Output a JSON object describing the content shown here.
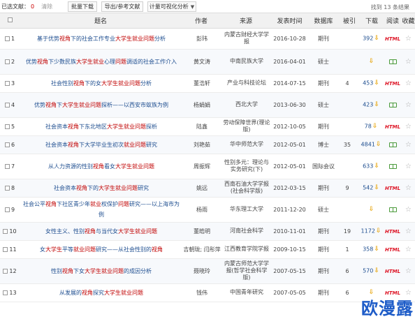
{
  "toolbar": {
    "selected_label": "已选文献：",
    "selected_count": "0",
    "clear_label": "清除",
    "batch_download": "批量下载",
    "export": "导出/参考文献",
    "visualize": "计量可视化分析",
    "found_text": "找到 13 条结果"
  },
  "columns": [
    "",
    "题名",
    "作者",
    "来源",
    "发表时间",
    "数据库",
    "被引",
    "下载",
    "阅读",
    "收藏"
  ],
  "rows": [
    {
      "num": "1",
      "title": "基于优势视角下的社会工作专业大学生就业问题分析",
      "author": "彭玮",
      "source": "内蒙古财经大学学报",
      "date": "2016-10-28",
      "db": "期刊",
      "cite": "",
      "downloads": "392",
      "read": "html"
    },
    {
      "num": "2",
      "title": "优势视角下少数民族大学生就业心理问题调适的社会工作介入",
      "author": "黄文涛",
      "source": "中南民族大学",
      "date": "2016-04-01",
      "db": "硕士",
      "cite": "",
      "downloads": "",
      "read": "book"
    },
    {
      "num": "3",
      "title": "社会性别视角下的女大学生就业问题分析",
      "author": "董浩轩",
      "source": "产业与科技论坛",
      "date": "2014-07-15",
      "db": "期刊",
      "cite": "4",
      "downloads": "453",
      "read": "html"
    },
    {
      "num": "4",
      "title": "优势视角下大学生就业问题探析——以西安市蚁族为例",
      "author": "杨娟娟",
      "source": "西北大学",
      "date": "2013-06-30",
      "db": "硕士",
      "cite": "",
      "downloads": "423",
      "read": "book"
    },
    {
      "num": "5",
      "title": "社会资本视角下东北地区大学生就业问题探析",
      "author": "陆鑫",
      "source": "劳动保障世界(理论版)",
      "date": "2012-10-05",
      "db": "期刊",
      "cite": "",
      "downloads": "78",
      "read": "html"
    },
    {
      "num": "6",
      "title": "社会资本视角下大学毕业生初次就业问题研究",
      "author": "刘艳茹",
      "source": "华中师范大学",
      "date": "2012-05-01",
      "db": "博士",
      "cite": "35",
      "downloads": "4841",
      "read": "book"
    },
    {
      "num": "7",
      "title": "从人力资源的性别视角看女大学生就业问题",
      "author": "周振辉",
      "source": "性别多元：理论与实务研究(下)",
      "date": "2012-05-01",
      "db": "国际会议",
      "cite": "",
      "downloads": "633",
      "read": "book"
    },
    {
      "num": "8",
      "title": "社会资本视角下的大学生就业问题研究",
      "author": "姚远",
      "source": "西南石油大学学报(社会科学版)",
      "date": "2012-03-15",
      "db": "期刊",
      "cite": "9",
      "downloads": "542",
      "read": "html"
    },
    {
      "num": "9",
      "title": "社会公平视角下社区青少年就业权保护问题研究——以上海市为例",
      "author": "杨雨",
      "source": "华东理工大学",
      "date": "2011-12-20",
      "db": "硕士",
      "cite": "",
      "downloads": "",
      "read": "book"
    },
    {
      "num": "10",
      "title": "女性主义、性别视角与当代女大学生就业问题",
      "author": "董皓明",
      "source": "河南社会科学",
      "date": "2010-11-01",
      "db": "期刊",
      "cite": "19",
      "downloads": "1172",
      "read": "html"
    },
    {
      "num": "11",
      "title": "女大学生平等就业问题研究——从社会性别的视角",
      "author": "吉朝珑; 闫彤萍",
      "source": "江西教育学院学报",
      "date": "2009-10-15",
      "db": "期刊",
      "cite": "1",
      "downloads": "358",
      "read": "html"
    },
    {
      "num": "12",
      "title": "性别视角下女大学生就业问题的成因分析",
      "author": "聂晓玲",
      "source": "内蒙古师范大学学报(哲学社会科学版)",
      "date": "2007-05-15",
      "db": "期刊",
      "cite": "6",
      "downloads": "570",
      "read": "html"
    },
    {
      "num": "13",
      "title": "从发展的视角探究大学生就业问题",
      "author": "钱伟",
      "source": "中国青年研究",
      "date": "2007-05-05",
      "db": "期刊",
      "cite": "6",
      "downloads": "",
      "read": "html"
    }
  ],
  "icons": {
    "download": "download-icon",
    "html": "HTML",
    "book": "book-icon",
    "star": "star-icon"
  },
  "colors": {
    "link": "#1d4d8f",
    "highlight": "#c00000",
    "html_badge": "#dd1111",
    "download": "#e6a100"
  },
  "watermark": "欧漫露"
}
